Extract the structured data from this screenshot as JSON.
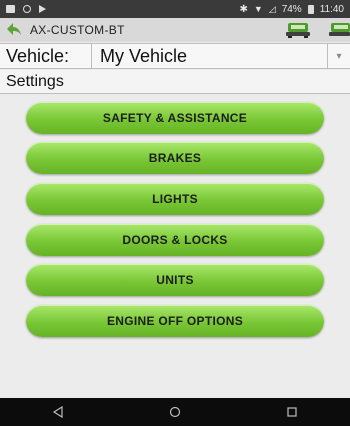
{
  "status_bar": {
    "battery": "74%",
    "time": "11:40"
  },
  "app_bar": {
    "title": "AX-CUSTOM-BT"
  },
  "vehicle": {
    "label": "Vehicle:",
    "selected": "My Vehicle"
  },
  "section": {
    "title": "Settings"
  },
  "menu": {
    "items": [
      {
        "label": "SAFETY & ASSISTANCE"
      },
      {
        "label": "BRAKES"
      },
      {
        "label": "LIGHTS"
      },
      {
        "label": "DOORS & LOCKS"
      },
      {
        "label": "UNITS"
      },
      {
        "label": "ENGINE OFF OPTIONS"
      }
    ]
  },
  "colors": {
    "accent_green": "#79c735",
    "status_bar_bg": "#3a3a3a",
    "nav_bar_bg": "#0c0c0c"
  },
  "icons": {
    "back": "back-arrow-icon",
    "car_left": "car-icon",
    "car_right": "car-icon",
    "nav_back": "nav-back-icon",
    "nav_home": "nav-home-icon",
    "nav_recents": "nav-recents-icon"
  }
}
